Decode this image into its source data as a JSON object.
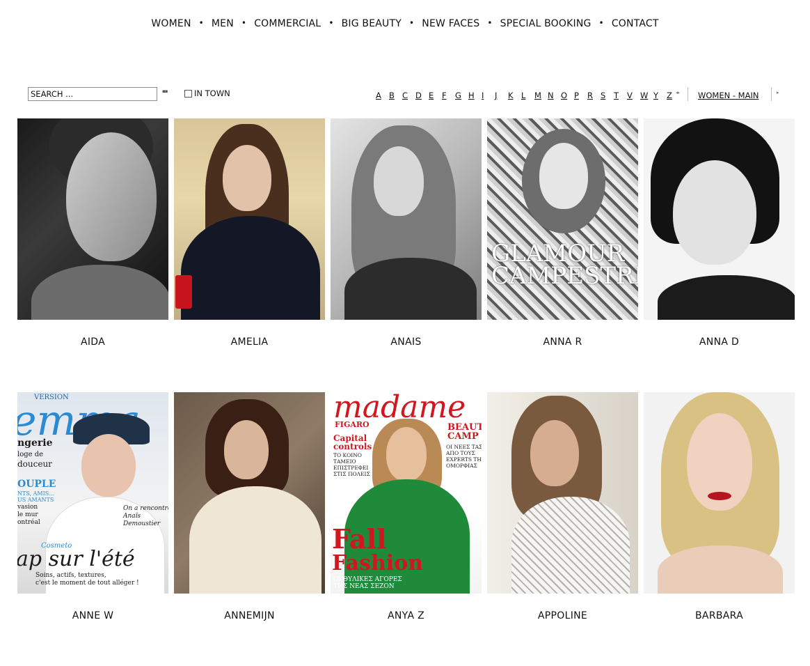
{
  "nav": {
    "items": [
      "WOMEN",
      "MEN",
      "COMMERCIAL",
      "BIG BEAUTY",
      "NEW FACES",
      "SPECIAL BOOKING",
      "CONTACT"
    ],
    "separator": "•"
  },
  "search": {
    "placeholder": "SEARCH ..."
  },
  "filter": {
    "in_town_label": "IN TOWN",
    "in_town_checked": false
  },
  "alphabet": [
    "A",
    "B",
    "C",
    "D",
    "E",
    "F",
    "G",
    "H",
    "I",
    "J",
    "K",
    "L",
    "M",
    "N",
    "O",
    "P",
    "R",
    "S",
    "T",
    "V",
    "W",
    "Y",
    "Z"
  ],
  "category_link": "WOMEN - MAIN",
  "models": [
    {
      "name": "AIDA"
    },
    {
      "name": "AMELIA"
    },
    {
      "name": "ANAIS"
    },
    {
      "name": "ANNA R"
    },
    {
      "name": "ANNA D"
    },
    {
      "name": "ANNE W",
      "cover_text": {
        "masthead": "emma",
        "kicker": "VERSION",
        "lingerie": "ngerie",
        "eloge": "loge de",
        "douceur": "douceur",
        "couple": "OUPLE",
        "amants": "NTS, AMIS...\nUS AMANTS",
        "vasion": "vasion\nle mur\nontréal",
        "rencontre": "On a rencontré\nAnaïs\nDemoustier",
        "cosmeto": "Cosmeto",
        "headline": "ap sur l'été",
        "sub": "Soins, actifs, textures,\nc'est le moment de tout alléger !"
      }
    },
    {
      "name": "ANNEMIJN"
    },
    {
      "name": "ANYA Z",
      "cover_text": {
        "masthead": "madame",
        "figaro": "FIGARO",
        "beauty": "BEAUTY\nCAMP",
        "beauty_sub": "ΟΙ ΝΕΕΣ ΤΑΣΕΙΣ\nΑΠΟ ΤΟΥΣ\nEXPERTS ΤΗΣ\nΟΜΟΡΦΙΑΣ",
        "capital": "Capital\ncontrols",
        "capital_sub": "ΤΟ ΚΟΙΝΟ\nΤΑΜΕΙΟ\nΕΠΙΣΤΡΕΦΕΙ\nΣΤΙΣ ΠΟΛΕΙΣ",
        "fall": "Fall",
        "fashion": "Fashion",
        "bottom": "ΟΙ ΘΥΛΙΚΕΣ ΑΓΟΡΕΣ\nΤΗΣ ΝΕΑΣ ΣΕΖΟΝ"
      }
    },
    {
      "name": "APPOLINE"
    },
    {
      "name": "BARBARA"
    }
  ],
  "anna_r_cover": {
    "headline": "GLAMOUR\nCAMPESTRE"
  }
}
